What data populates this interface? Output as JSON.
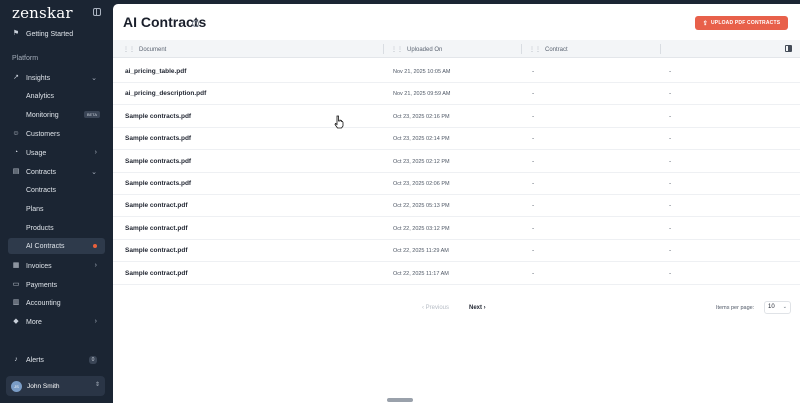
{
  "brand": {
    "name": "zenskar"
  },
  "sidebar": {
    "getting_started": "Getting Started",
    "section_platform": "Platform",
    "insights": "Insights",
    "analytics": "Analytics",
    "monitoring": "Monitoring",
    "monitoring_badge": "BETA",
    "customers": "Customers",
    "usage": "Usage",
    "contracts": "Contracts",
    "contracts_sub": "Contracts",
    "plans": "Plans",
    "products": "Products",
    "ai_contracts": "AI Contracts",
    "invoices": "Invoices",
    "payments": "Payments",
    "accounting": "Accounting",
    "more": "More",
    "alerts": "Alerts",
    "alerts_count": "0",
    "user": {
      "initials": "JS",
      "name": "John Smith"
    },
    "colors": {
      "bg": "#1b2533",
      "active_bg": "#2e3a4b",
      "dot": "#e8603c"
    }
  },
  "page": {
    "title": "AI Contracts",
    "upload_button": "UPLOAD PDF CONTRACTS",
    "accent": "#e8604a"
  },
  "table": {
    "columns": [
      "Document",
      "Uploaded On",
      "Contract"
    ],
    "rows": [
      {
        "document": "ai_pricing_table.pdf",
        "uploaded_on": "Nov 21, 2025 10:05 AM",
        "contract": "-",
        "extra": "-"
      },
      {
        "document": "ai_pricing_description.pdf",
        "uploaded_on": "Nov 21, 2025 09:59 AM",
        "contract": "-",
        "extra": "-"
      },
      {
        "document": "Sample contracts.pdf",
        "uploaded_on": "Oct 23, 2025 02:16 PM",
        "contract": "-",
        "extra": "-"
      },
      {
        "document": "Sample contracts.pdf",
        "uploaded_on": "Oct 23, 2025 02:14 PM",
        "contract": "-",
        "extra": "-"
      },
      {
        "document": "Sample contracts.pdf",
        "uploaded_on": "Oct 23, 2025 02:12 PM",
        "contract": "-",
        "extra": "-"
      },
      {
        "document": "Sample contracts.pdf",
        "uploaded_on": "Oct 23, 2025 02:06 PM",
        "contract": "-",
        "extra": "-"
      },
      {
        "document": "Sample contract.pdf",
        "uploaded_on": "Oct 22, 2025 05:13 PM",
        "contract": "-",
        "extra": "-"
      },
      {
        "document": "Sample contract.pdf",
        "uploaded_on": "Oct 22, 2025 03:12 PM",
        "contract": "-",
        "extra": "-"
      },
      {
        "document": "Sample contract.pdf",
        "uploaded_on": "Oct 22, 2025 11:29 AM",
        "contract": "-",
        "extra": "-"
      },
      {
        "document": "Sample contract.pdf",
        "uploaded_on": "Oct 22, 2025 11:17 AM",
        "contract": "-",
        "extra": "-"
      }
    ]
  },
  "pagination": {
    "previous": "Previous",
    "next": "Next",
    "items_per_page_label": "Items per page:",
    "items_per_page_value": "10"
  },
  "icons": {
    "collapse": "sidebar-collapse-icon",
    "upload": "upload-icon",
    "info": "info-icon",
    "columns": "column-toggle-icon"
  }
}
